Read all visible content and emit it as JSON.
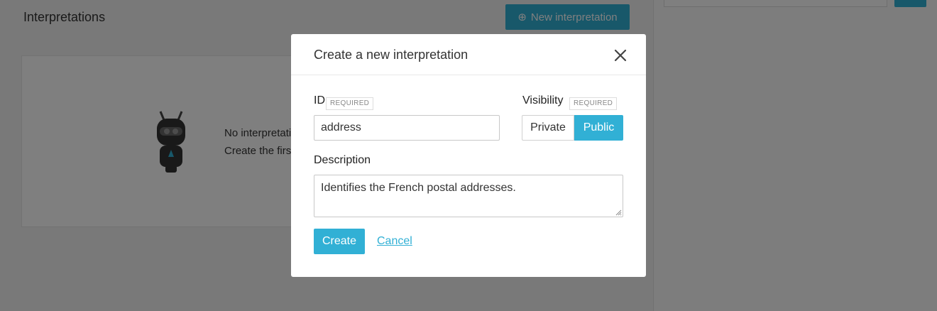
{
  "background": {
    "section_title": "Interpretations",
    "new_button_label": "New interpretation",
    "empty_line_1": "No interpretation",
    "empty_line_2": "Create the first"
  },
  "modal": {
    "title": "Create a new interpretation",
    "id_label": "ID",
    "id_required_badge": "REQUIRED",
    "id_value": "address",
    "visibility_label": "Visibility",
    "visibility_required_badge": "REQUIRED",
    "visibility_options": [
      "Private",
      "Public"
    ],
    "visibility_selected": "Public",
    "description_label": "Description",
    "description_value": "Identifies the French postal addresses.",
    "create_label": "Create",
    "cancel_label": "Cancel"
  },
  "colors": {
    "accent": "#31b0d5",
    "overlay": "rgba(0,0,0,0.5)"
  }
}
